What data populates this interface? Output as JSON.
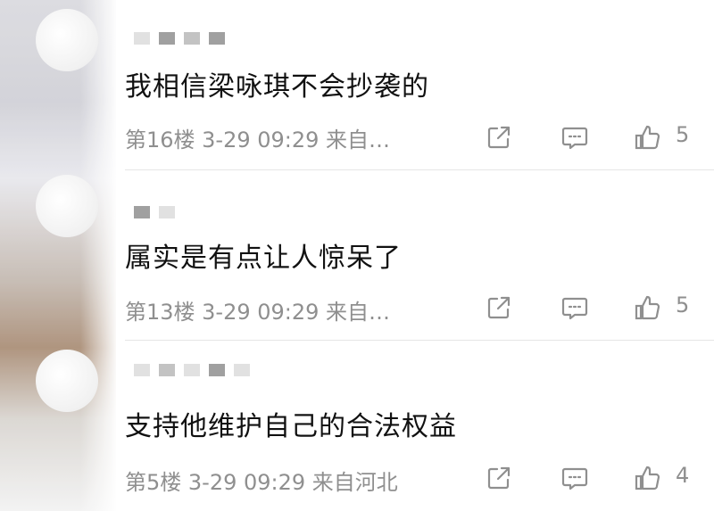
{
  "comments": [
    {
      "text": "我相信梁咏琪不会抄袭的",
      "meta": "第16楼 3-29 09:29 来自…",
      "likes": "5"
    },
    {
      "text": "属实是有点让人惊呆了",
      "meta": "第13楼 3-29 09:29 来自…",
      "likes": "5"
    },
    {
      "text": "支持他维护自己的合法权益",
      "meta": "第5楼 3-29 09:29 来自河北",
      "likes": "4"
    }
  ],
  "icons": {
    "share": "share-icon",
    "reply": "comment-icon",
    "like": "thumbs-up-icon"
  },
  "colors": {
    "meta_text": "#8f8f8f",
    "comment_text": "#111111",
    "divider": "#e6e6e6"
  }
}
